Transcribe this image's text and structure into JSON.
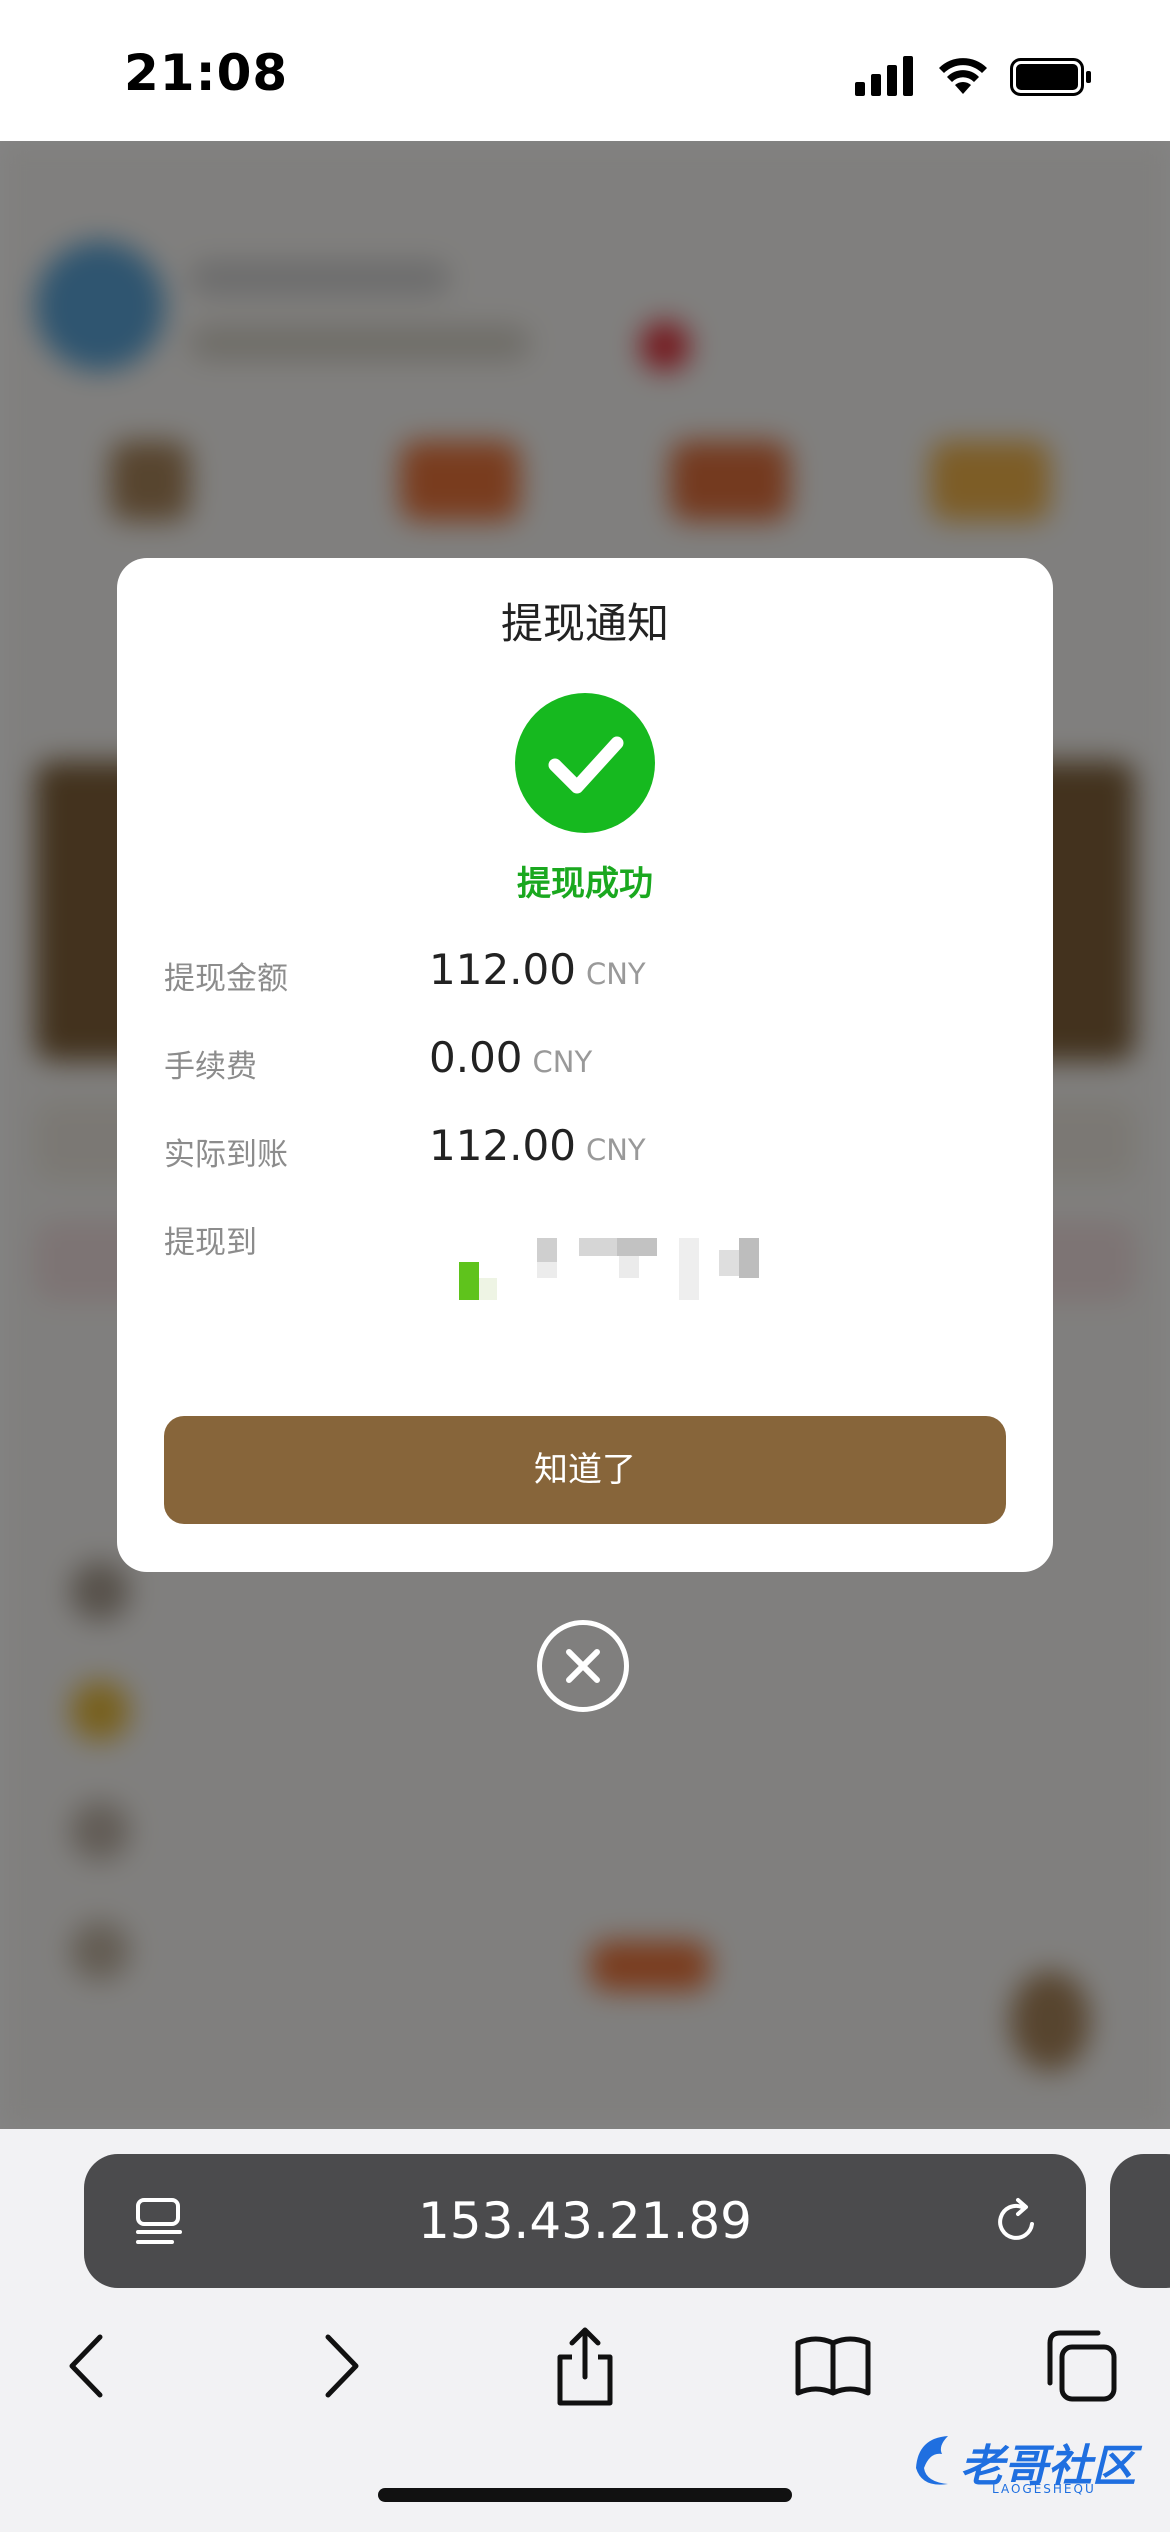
{
  "status_bar": {
    "time": "21:08"
  },
  "modal": {
    "title": "提现通知",
    "status_text": "提现成功",
    "rows": [
      {
        "label": "提现金额",
        "value": "112.00",
        "unit": "CNY"
      },
      {
        "label": "手续费",
        "value": "0.00",
        "unit": "CNY"
      },
      {
        "label": "实际到账",
        "value": "112.00",
        "unit": "CNY"
      },
      {
        "label": "提现到",
        "value": "",
        "unit": ""
      }
    ],
    "confirm_label": "知道了"
  },
  "browser": {
    "url": "153.43.21.89"
  },
  "watermark": {
    "text": "老哥社区",
    "subtext": "LAOGESHEQU"
  },
  "colors": {
    "accent_brown": "#87653a",
    "success_green": "#16b91f",
    "url_pill": "#4b4b4d"
  },
  "icons": [
    "signal-icon",
    "wifi-icon",
    "battery-icon",
    "check-icon",
    "close-icon",
    "tab-list-icon",
    "reload-icon",
    "back-icon",
    "forward-icon",
    "share-icon",
    "bookmarks-icon",
    "tabs-icon"
  ]
}
